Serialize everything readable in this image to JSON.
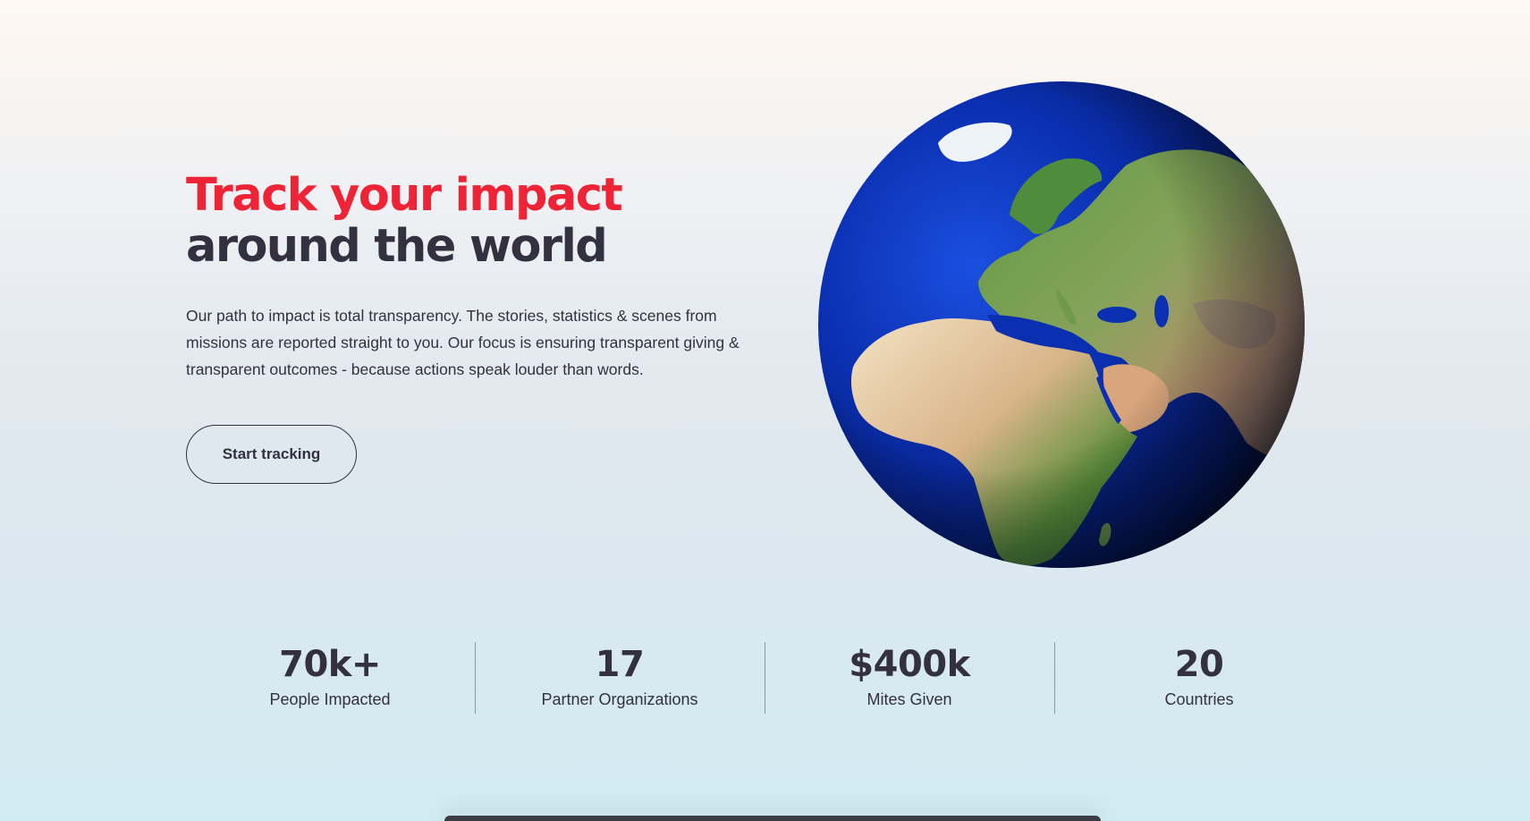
{
  "hero": {
    "title_line1": "Track your impact",
    "title_line2": "around the world",
    "description": "Our path to impact is total transparency. The stories, statistics & scenes from missions are reported straight to you. Our focus is ensuring transparent giving & transparent outcomes - because actions speak louder than words.",
    "cta_label": "Start tracking"
  },
  "globe": {
    "icon": "earth-globe-icon"
  },
  "stats": [
    {
      "value": "70k+",
      "label": "People Impacted"
    },
    {
      "value": "17",
      "label": "Partner Organizations"
    },
    {
      "value": "$400k",
      "label": "Mites Given"
    },
    {
      "value": "20",
      "label": "Countries"
    }
  ],
  "colors": {
    "accent": "#ee2436",
    "text_dark": "#33313f",
    "ocean": "#0b35b8"
  }
}
